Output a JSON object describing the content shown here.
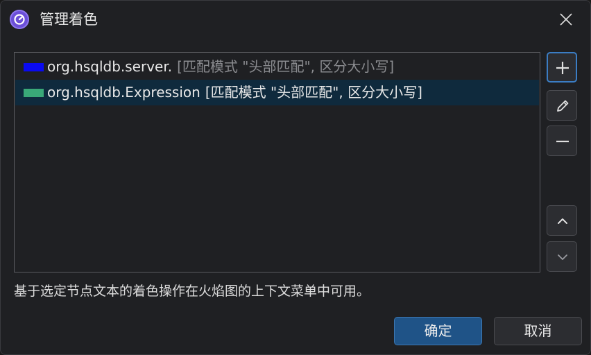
{
  "window": {
    "title": "管理着色"
  },
  "rules": [
    {
      "pattern": "org.hsqldb.server.",
      "options": "[匹配模式 \"头部匹配\", 区分大小写]",
      "color": "#0a0af0",
      "selected": false
    },
    {
      "pattern": "org.hsqldb.Expression",
      "options": "[匹配模式 \"头部匹配\", 区分大小写]",
      "color": "#3aa878",
      "selected": true
    }
  ],
  "side_buttons": {
    "add": "plus-icon",
    "edit": "pencil-icon",
    "remove": "minus-icon",
    "up": "chevron-up-icon",
    "down": "chevron-down-icon"
  },
  "hint": "基于选定节点文本的着色操作在火焰图的上下文菜单中可用。",
  "footer": {
    "ok_label": "确定",
    "cancel_label": "取消"
  },
  "colors": {
    "accent": "#3b7dc4",
    "selection": "#0f2a3d",
    "app_icon": "#6b4fd8"
  }
}
